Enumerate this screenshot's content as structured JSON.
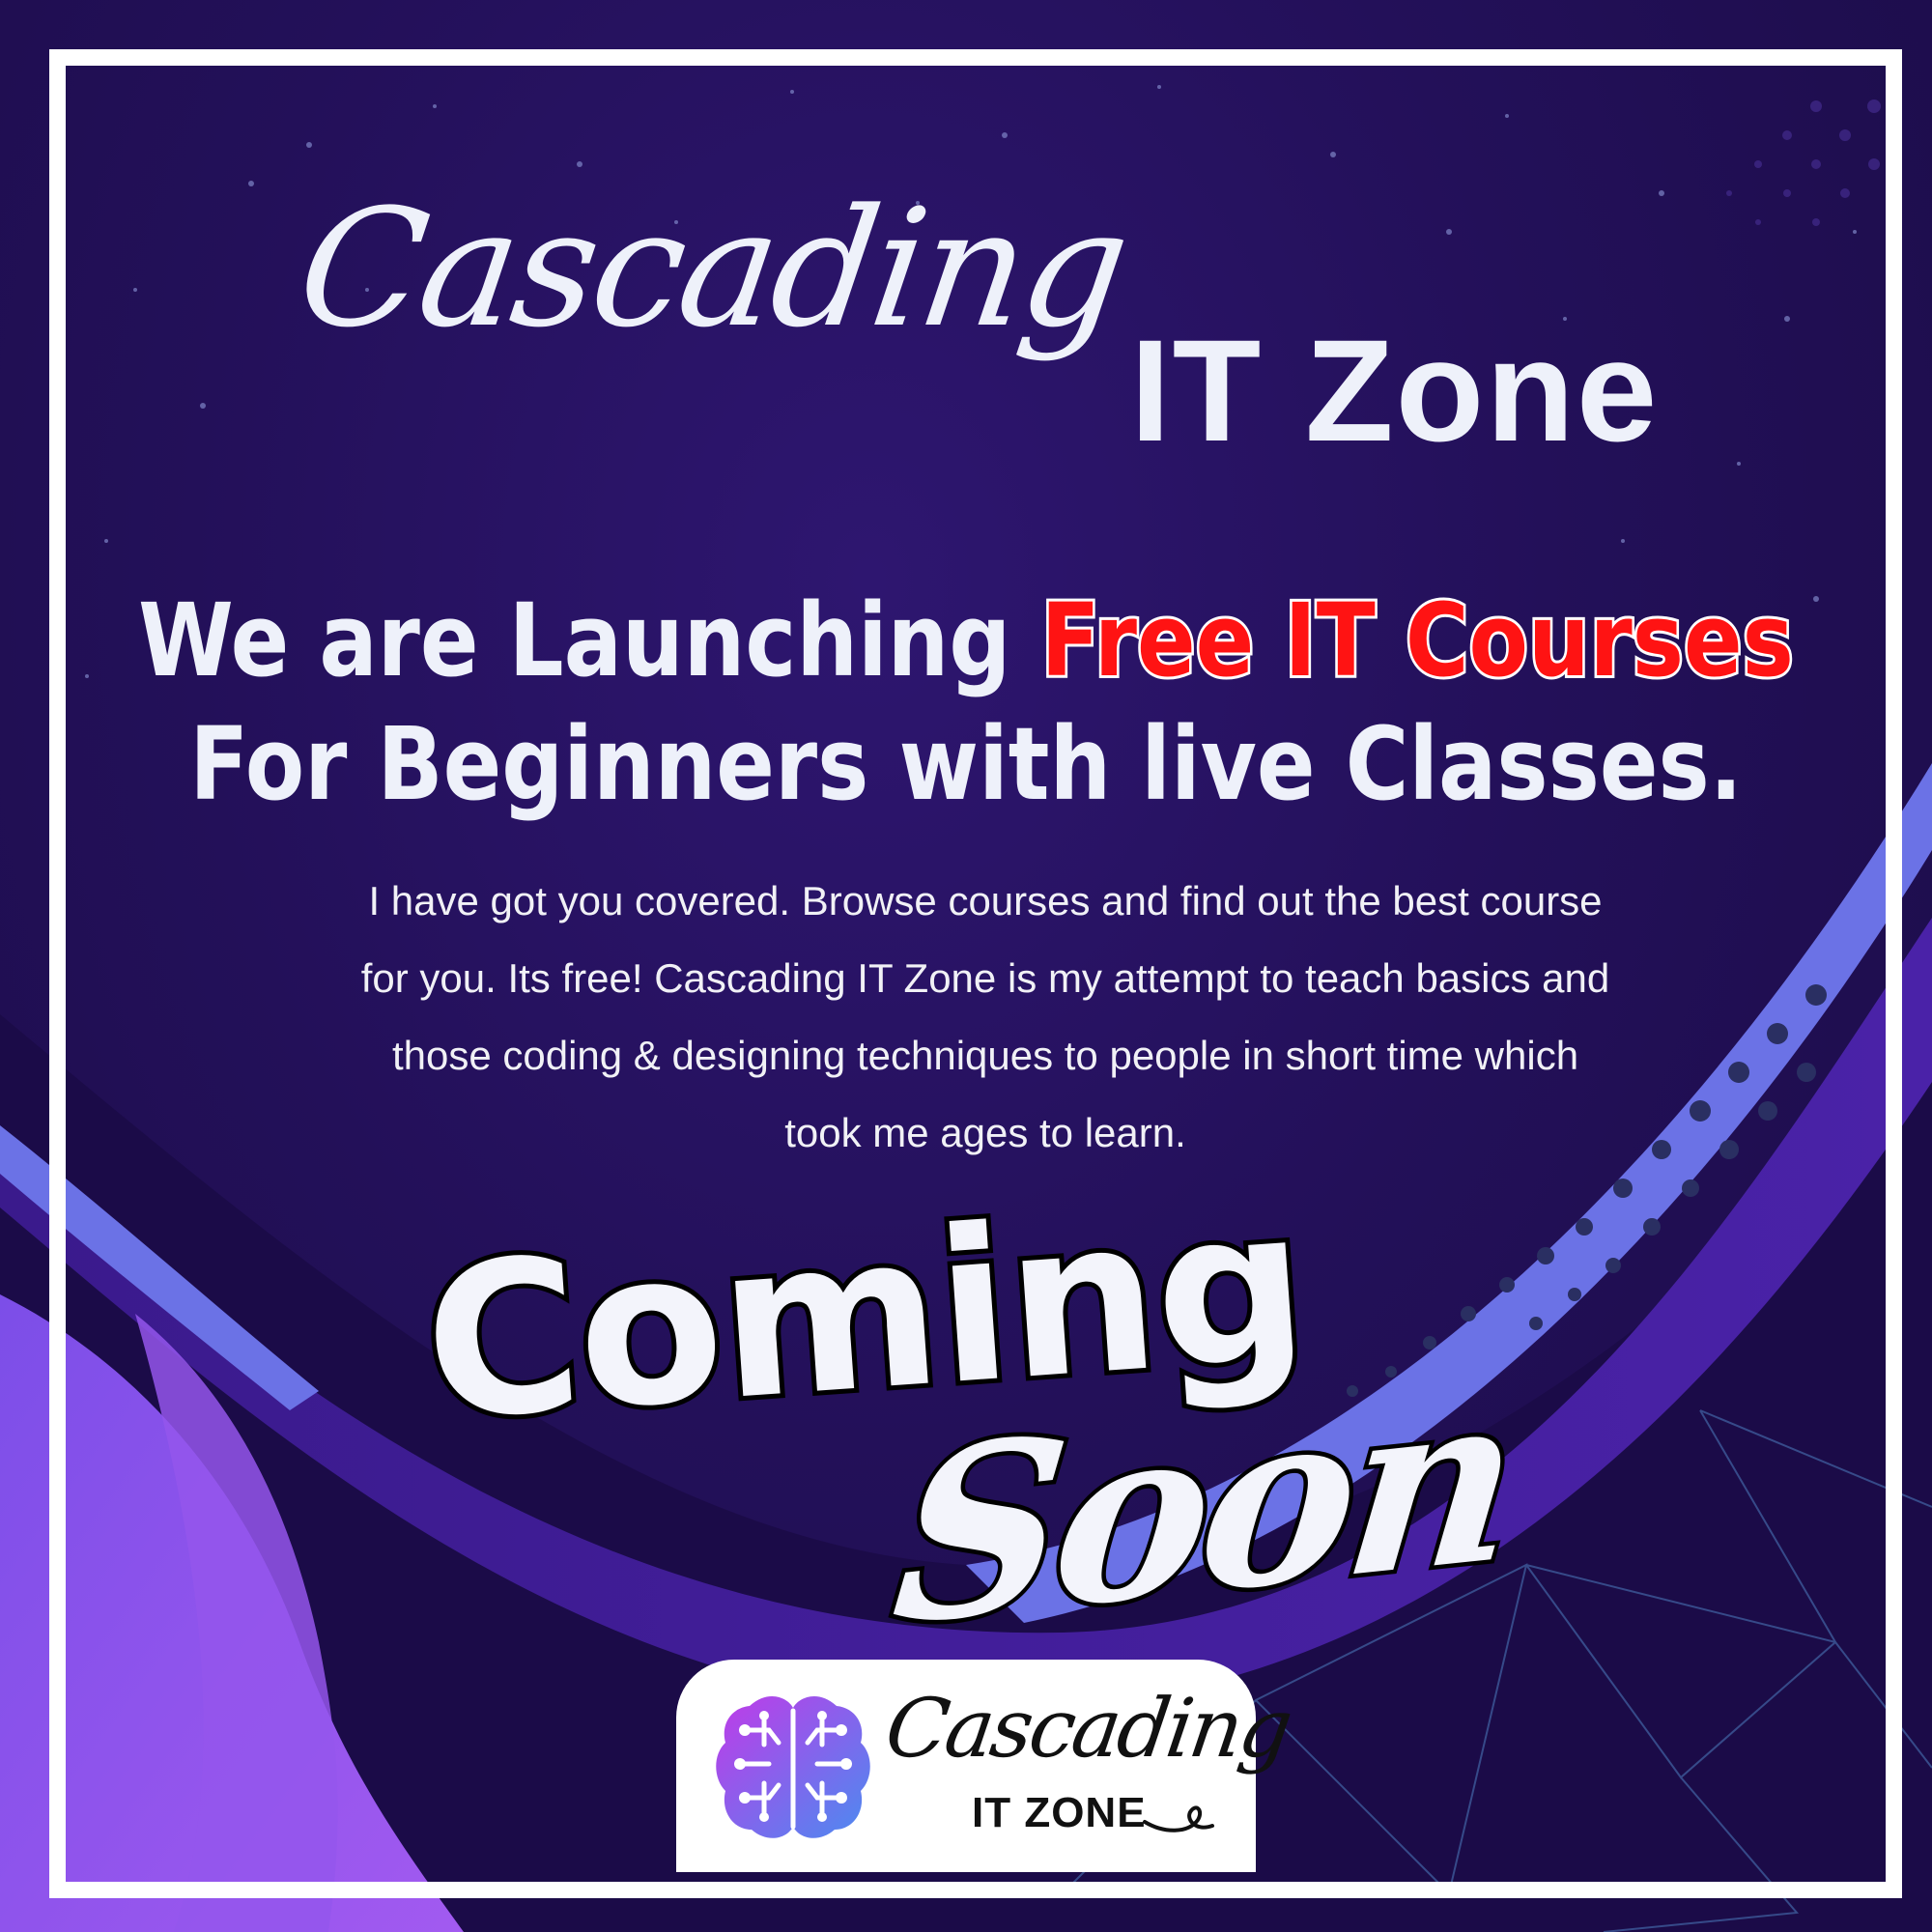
{
  "brand": {
    "script_word": "Cascading",
    "bold_word": "IT Zone"
  },
  "headline": {
    "line1_prefix": "We are Launching ",
    "line1_highlight": "Free IT Courses",
    "line2": "For Beginners with live Classes."
  },
  "body": {
    "lines": [
      "I have got you covered. Browse courses and find out the best course",
      "for you. Its free! Cascading IT Zone is my attempt to teach basics and",
      "those coding &  designing techniques to people in short time which",
      "took me ages to learn."
    ]
  },
  "announcement": {
    "coming": "Coming",
    "soon": "Soon"
  },
  "logo": {
    "script": "Cascading",
    "sub": "IT ZONE",
    "icon": "brain-circuit-icon"
  },
  "colors": {
    "background": "#231059",
    "frame": "#ffffff",
    "highlight": "#ff1313",
    "ribbon": "#6b72e6",
    "wave": "#9a55ee"
  }
}
